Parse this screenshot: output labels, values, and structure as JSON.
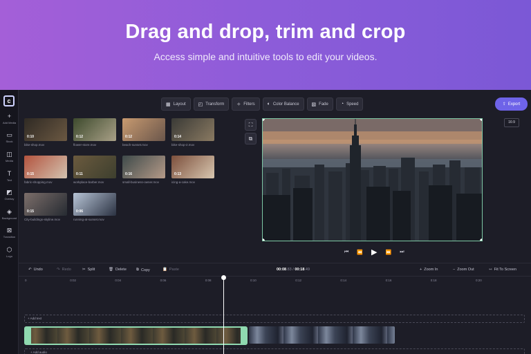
{
  "banner": {
    "title": "Drag and drop, trim and crop",
    "subtitle": "Access simple and intuitive tools to edit your videos."
  },
  "nav": [
    {
      "icon": "plus-icon",
      "glyph": "+",
      "label": "Add Media"
    },
    {
      "icon": "stock-icon",
      "glyph": "▭",
      "label": "Stock"
    },
    {
      "icon": "media-icon",
      "glyph": "◫",
      "label": "Media"
    },
    {
      "icon": "text-icon",
      "glyph": "T",
      "label": "Text"
    },
    {
      "icon": "overlay-icon",
      "glyph": "◩",
      "label": "Overlay"
    },
    {
      "icon": "background-icon",
      "glyph": "◈",
      "label": "Background"
    },
    {
      "icon": "transition-icon",
      "glyph": "⊠",
      "label": "Transition"
    },
    {
      "icon": "logo-icon",
      "glyph": "⬡",
      "label": "Logo"
    }
  ],
  "toolbar": [
    {
      "icon": "layout-icon",
      "glyph": "▦",
      "label": "Layout"
    },
    {
      "icon": "transform-icon",
      "glyph": "◰",
      "label": "Transform"
    },
    {
      "icon": "filters-icon",
      "glyph": "✧",
      "label": "Filters"
    },
    {
      "icon": "color-balance-icon",
      "glyph": "◐",
      "label": "Color Balance"
    },
    {
      "icon": "fade-icon",
      "glyph": "▧",
      "label": "Fade"
    },
    {
      "icon": "speed-icon",
      "glyph": "◔",
      "label": "Speed"
    }
  ],
  "export_label": "Export",
  "aspect_ratio": "16:9",
  "media": [
    {
      "duration": "0:10",
      "name": "bike-shop.mov",
      "colors": [
        "#2f2a24",
        "#6b5842"
      ]
    },
    {
      "duration": "0:12",
      "name": "flower-store.mov",
      "colors": [
        "#3d4a2d",
        "#a9a087"
      ]
    },
    {
      "duration": "0:12",
      "name": "beach-sunset.mov",
      "colors": [
        "#c89a70",
        "#6a564b"
      ]
    },
    {
      "duration": "0:14",
      "name": "bike-shop-2.mov",
      "colors": [
        "#3a3a36",
        "#8a7a62"
      ]
    },
    {
      "duration": "0:15",
      "name": "fabric-shopping.mov",
      "colors": [
        "#b3533e",
        "#d3c3b0"
      ]
    },
    {
      "duration": "0:11",
      "name": "workplace-barber.mov",
      "colors": [
        "#6b5a3e",
        "#3d3f2e"
      ]
    },
    {
      "duration": "0:16",
      "name": "small-business-owner.mov",
      "colors": [
        "#3e4a4a",
        "#b59a88"
      ]
    },
    {
      "duration": "0:13",
      "name": "icing-a-cake.mov",
      "colors": [
        "#7c4f3c",
        "#d8c7b0"
      ]
    },
    {
      "duration": "0:15",
      "name": "City-buildings-skyline.mov",
      "colors": [
        "#7c6e6a",
        "#262b32"
      ]
    },
    {
      "duration": "0:06",
      "name": "running-at-sunset.mov",
      "colors": [
        "#b7c4d6",
        "#2b3242"
      ]
    }
  ],
  "timeline": {
    "undo": "Undo",
    "redo": "Redo",
    "split": "Split",
    "delete": "Delete",
    "copy": "Copy",
    "paste": "Paste",
    "time_current": "00:08",
    "time_current_frac": ".83",
    "time_total": "00:18",
    "time_total_frac": ".49",
    "zoom_in": "Zoom In",
    "zoom_out": "Zoom Out",
    "fit": "Fit To Screen",
    "ruler": [
      "0",
      "0:02",
      "0:04",
      "0:06",
      "0:08",
      "0:10",
      "0:12",
      "0:14",
      "0:16",
      "0:18",
      "0:20"
    ],
    "add_text": "+ Add text",
    "add_audio": "+ Add audio"
  }
}
